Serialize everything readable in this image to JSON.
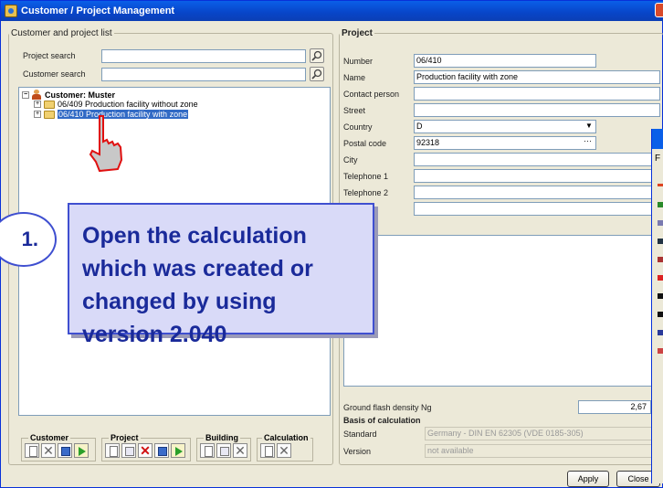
{
  "window": {
    "title": "Customer / Project Management"
  },
  "left_panel": {
    "legend": "Customer and project list",
    "project_search_label": "Project search",
    "customer_search_label": "Customer search",
    "project_search_value": "",
    "customer_search_value": ""
  },
  "tree": {
    "customer": "Customer: Muster",
    "items": [
      {
        "label": "06/409 Production facility without zone"
      },
      {
        "label": "06/410 Production facility with zone"
      }
    ]
  },
  "toolbar": {
    "customer": "Customer",
    "project": "Project",
    "building": "Building",
    "calculation": "Calculation"
  },
  "project": {
    "legend": "Project",
    "fields": {
      "number": {
        "label": "Number",
        "value": "06/410"
      },
      "name": {
        "label": "Name",
        "value": "Production facility with zone"
      },
      "contact": {
        "label": "Contact person",
        "value": ""
      },
      "street": {
        "label": "Street",
        "value": ""
      },
      "country": {
        "label": "Country",
        "value": "D"
      },
      "postal": {
        "label": "Postal code",
        "value": "92318"
      },
      "city": {
        "label": "City",
        "value": ""
      },
      "tel1": {
        "label": "Telephone 1",
        "value": ""
      },
      "tel2": {
        "label": "Telephone 2",
        "value": ""
      }
    },
    "ground_flash_label": "Ground flash density Ng",
    "ground_flash_value": "2,67",
    "basis_heading": "Basis of calculation",
    "standard_label": "Standard",
    "standard_value": "Germany - DIN EN 62305 (VDE 0185-305)",
    "version_label": "Version",
    "version_value": "not available",
    "apply": "Apply",
    "close": "Close"
  },
  "callout": {
    "number": "1.",
    "text": "Open the calculation which was created or changed by using version 2.040"
  },
  "child_window": {
    "menu_letter": "F"
  },
  "colors": {
    "callout_bg": "#d9daf8",
    "callout_text": "#1a2a9a",
    "title_bar": "#0a5fe8"
  }
}
